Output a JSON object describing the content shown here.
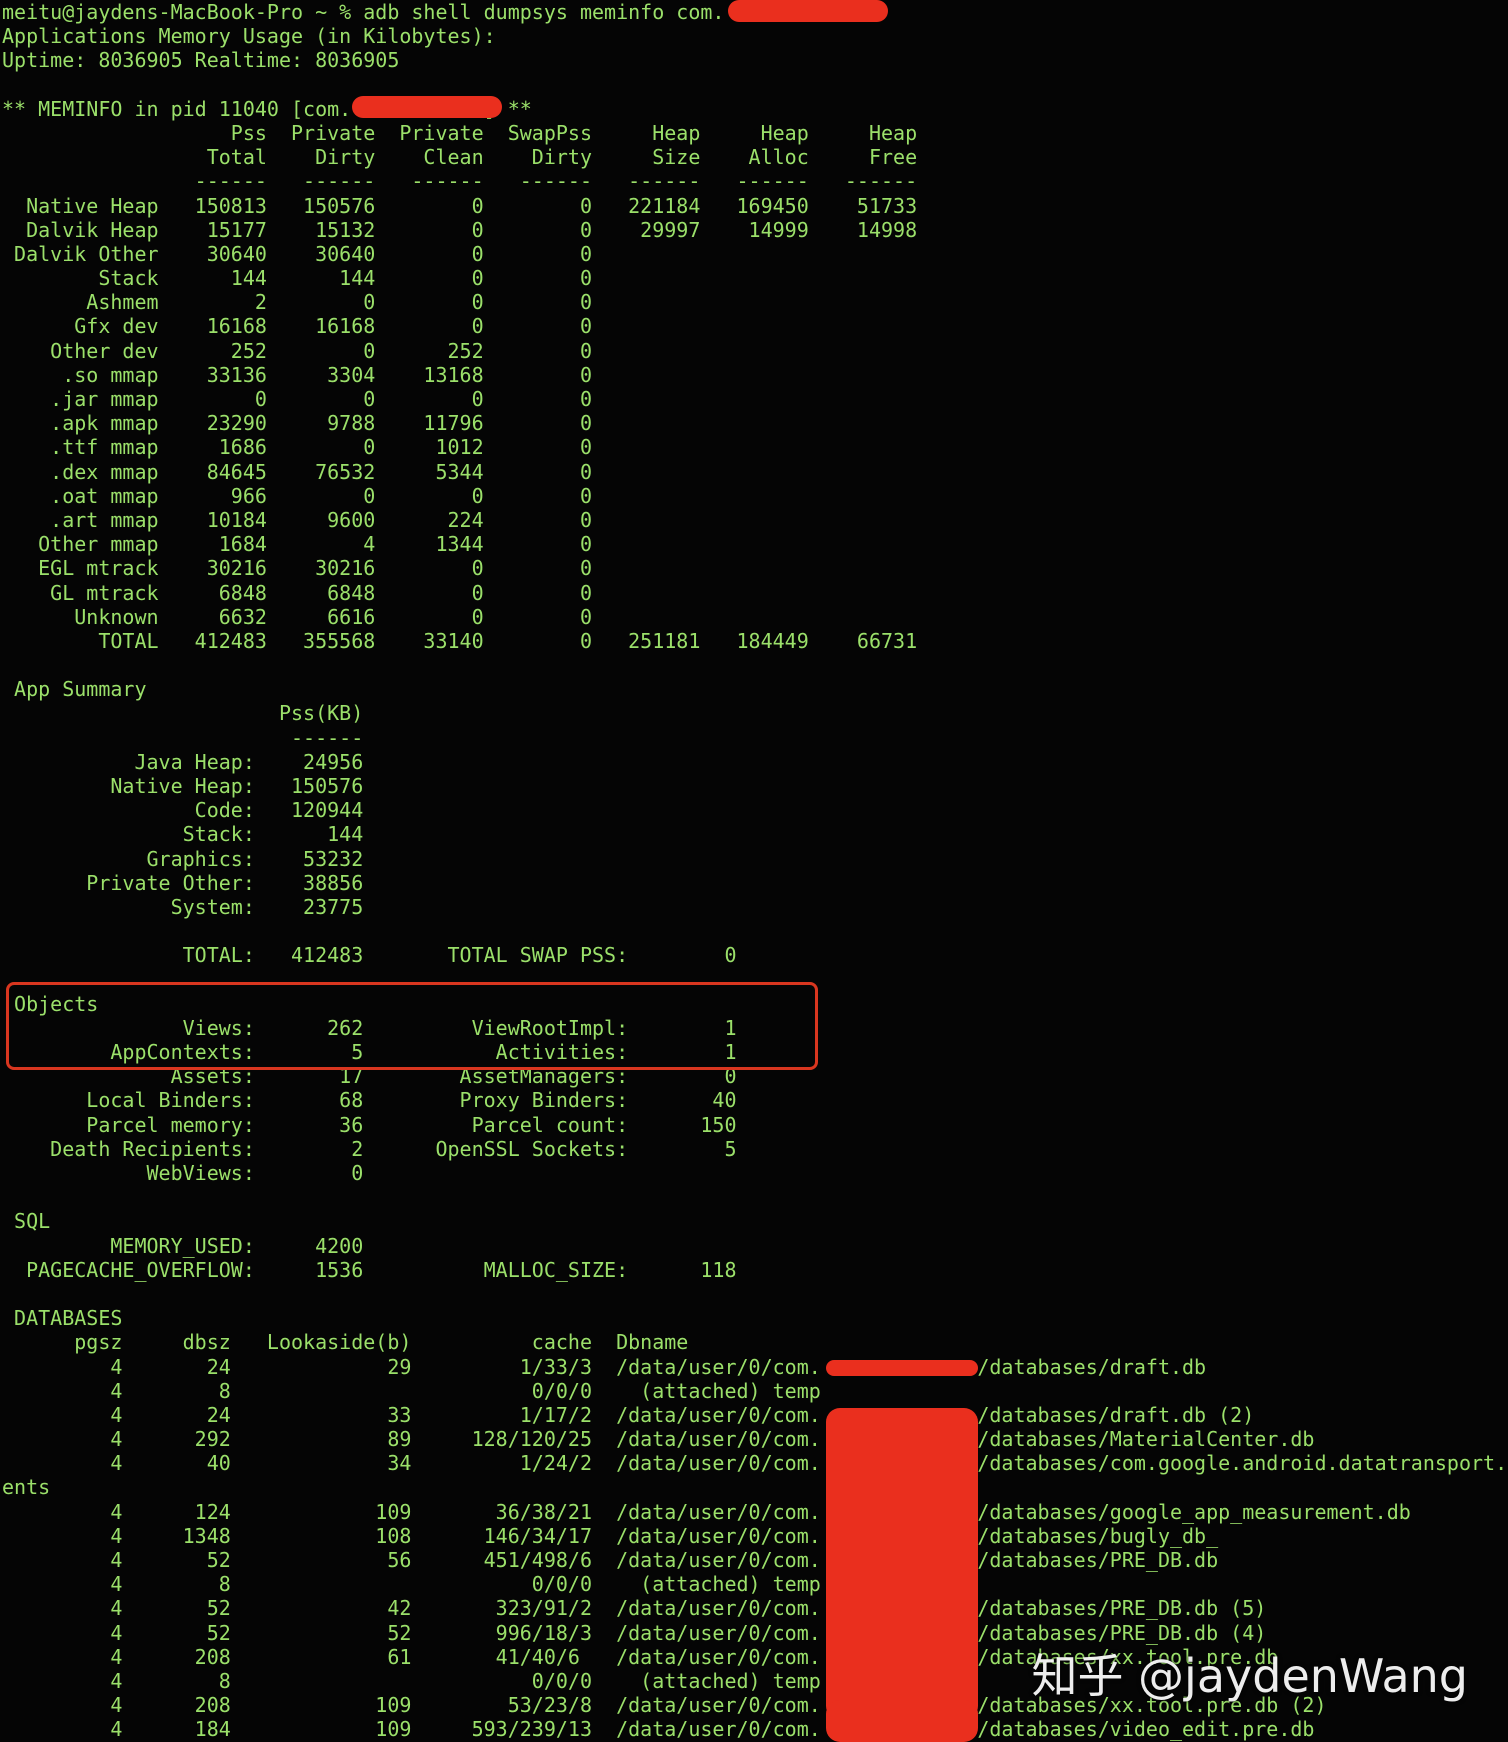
{
  "colors": {
    "terminal_text": "#9be06a",
    "background": "#050505",
    "redaction": "#ea2f1e"
  },
  "terminal": {
    "lines": [
      "meitu@jaydens-MacBook-Pro ~ % adb shell dumpsys meminfo com.           -d",
      "Applications Memory Usage (in Kilobytes):",
      "Uptime: 8036905 Realtime: 8036905",
      "",
      "** MEMINFO in pid 11040 [com.           ] **",
      "                   Pss  Private  Private  SwapPss     Heap     Heap     Heap",
      "                 Total    Dirty    Clean    Dirty     Size    Alloc     Free",
      "                ------   ------   ------   ------   ------   ------   ------",
      "  Native Heap   150813   150576        0        0   221184   169450    51733",
      "  Dalvik Heap    15177    15132        0        0    29997    14999    14998",
      " Dalvik Other    30640    30640        0        0",
      "        Stack      144      144        0        0",
      "       Ashmem        2        0        0        0",
      "      Gfx dev    16168    16168        0        0",
      "    Other dev      252        0      252        0",
      "     .so mmap    33136     3304    13168        0",
      "    .jar mmap        0        0        0        0",
      "    .apk mmap    23290     9788    11796        0",
      "    .ttf mmap     1686        0     1012        0",
      "    .dex mmap    84645    76532     5344        0",
      "    .oat mmap      966        0        0        0",
      "    .art mmap    10184     9600      224        0",
      "   Other mmap     1684        4     1344        0",
      "   EGL mtrack    30216    30216        0        0",
      "    GL mtrack     6848     6848        0        0",
      "      Unknown     6632     6616        0        0",
      "        TOTAL   412483   355568    33140        0   251181   184449    66731",
      "",
      " App Summary",
      "                       Pss(KB)",
      "                        ------",
      "           Java Heap:    24956",
      "         Native Heap:   150576",
      "                Code:   120944",
      "               Stack:      144",
      "            Graphics:    53232",
      "       Private Other:    38856",
      "              System:    23775",
      "",
      "               TOTAL:   412483       TOTAL SWAP PSS:        0",
      "",
      " Objects",
      "               Views:      262         ViewRootImpl:        1",
      "         AppContexts:        5           Activities:        1",
      "              Assets:       17        AssetManagers:        0",
      "       Local Binders:       68        Proxy Binders:       40",
      "       Parcel memory:       36         Parcel count:      150",
      "    Death Recipients:        2      OpenSSL Sockets:        5",
      "            WebViews:        0",
      "",
      " SQL",
      "         MEMORY_USED:     4200",
      "  PAGECACHE_OVERFLOW:     1536          MALLOC_SIZE:      118",
      "",
      " DATABASES",
      "      pgsz     dbsz   Lookaside(b)          cache  Dbname",
      "         4       24             29         1/33/3  /data/user/0/com.             /databases/draft.db",
      "         4        8                         0/0/0    (attached) temp",
      "         4       24             33         1/17/2  /data/user/0/com.             /databases/draft.db (2)",
      "         4      292             89     128/120/25  /data/user/0/com.             /databases/MaterialCenter.db",
      "         4       40             34         1/24/2  /data/user/0/com.             /databases/com.google.android.datatransport.ev",
      "ents",
      "         4      124            109       36/38/21  /data/user/0/com.             /databases/google_app_measurement.db",
      "         4     1348            108      146/34/17  /data/user/0/com.             /databases/bugly_db_",
      "         4       52             56      451/498/6  /data/user/0/com.             /databases/PRE_DB.db",
      "         4        8                         0/0/0    (attached) temp",
      "         4       52             42       323/91/2  /data/user/0/com.             /databases/PRE_DB.db (5)",
      "         4       52             52       996/18/3  /data/user/0/com.             /databases/PRE_DB.db (4)",
      "         4      208             61       41/40/6   /data/user/0/com.             /databases/xx.tool.pre.db",
      "         4        8                         0/0/0    (attached) temp",
      "         4      208            109        53/23/8  /data/user/0/com.             /databases/xx.tool.pre.db (2)",
      "         4      184            109     593/239/13  /data/user/0/com.             /databases/video_edit.pre.db"
    ]
  },
  "watermark": "知乎 @jaydenWang"
}
